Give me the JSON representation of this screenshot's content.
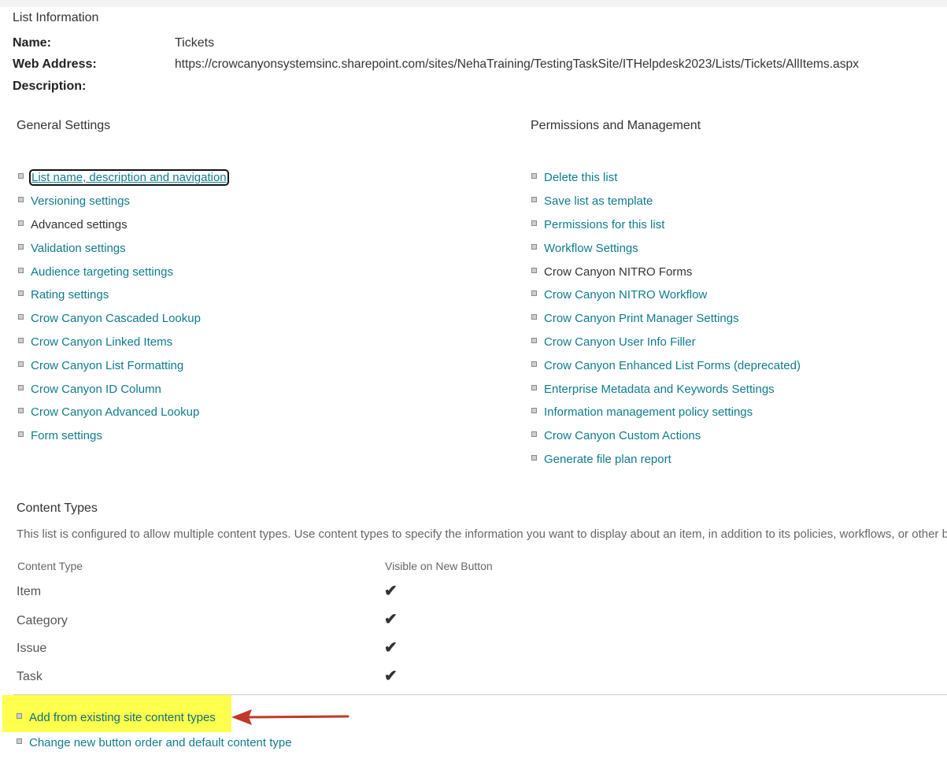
{
  "list_info": {
    "heading": "List Information",
    "name_label": "Name:",
    "name_value": "Tickets",
    "web_address_label": "Web Address:",
    "web_address_value": "https://crowcanyonsystemsinc.sharepoint.com/sites/NehaTraining/TestingTaskSite/ITHelpdesk2023/Lists/Tickets/AllItems.aspx",
    "description_label": "Description:"
  },
  "general_settings": {
    "heading": "General Settings",
    "items": [
      {
        "label": "List name, description and navigation"
      },
      {
        "label": "Versioning settings"
      },
      {
        "label": "Advanced settings"
      },
      {
        "label": "Validation settings"
      },
      {
        "label": "Audience targeting settings"
      },
      {
        "label": "Rating settings"
      },
      {
        "label": "Crow Canyon Cascaded Lookup"
      },
      {
        "label": "Crow Canyon Linked Items"
      },
      {
        "label": "Crow Canyon List Formatting"
      },
      {
        "label": "Crow Canyon ID Column"
      },
      {
        "label": "Crow Canyon Advanced Lookup"
      },
      {
        "label": "Form settings"
      }
    ]
  },
  "permissions_management": {
    "heading": "Permissions and Management",
    "items": [
      {
        "label": "Delete this list"
      },
      {
        "label": "Save list as template"
      },
      {
        "label": "Permissions for this list"
      },
      {
        "label": "Workflow Settings"
      },
      {
        "label": "Crow Canyon NITRO Forms"
      },
      {
        "label": "Crow Canyon NITRO Workflow"
      },
      {
        "label": "Crow Canyon Print Manager Settings"
      },
      {
        "label": "Crow Canyon User Info Filler"
      },
      {
        "label": "Crow Canyon Enhanced List Forms (deprecated)"
      },
      {
        "label": "Enterprise Metadata and Keywords Settings"
      },
      {
        "label": "Information management policy settings"
      },
      {
        "label": "Crow Canyon Custom Actions"
      },
      {
        "label": "Generate file plan report"
      }
    ]
  },
  "content_types": {
    "heading": "Content Types",
    "description": "This list is configured to allow multiple content types. Use content types to specify the information you want to display about an item, in addition to its policies, workflows, or other behavior. The following content types are currently available in this list:",
    "col_content_type": "Content Type",
    "col_visible": "Visible on New Button",
    "check_glyph": "✔",
    "rows": [
      {
        "name": "Item",
        "visible": true
      },
      {
        "name": "Category",
        "visible": true
      },
      {
        "name": "Issue",
        "visible": true
      },
      {
        "name": "Task",
        "visible": true
      }
    ],
    "actions": [
      {
        "label": "Add from existing site content types"
      },
      {
        "label": "Change new button order and default content type"
      }
    ]
  },
  "colors": {
    "link": "#0f7c8c",
    "highlight": "#ffff4d",
    "arrow": "#c0392b"
  }
}
